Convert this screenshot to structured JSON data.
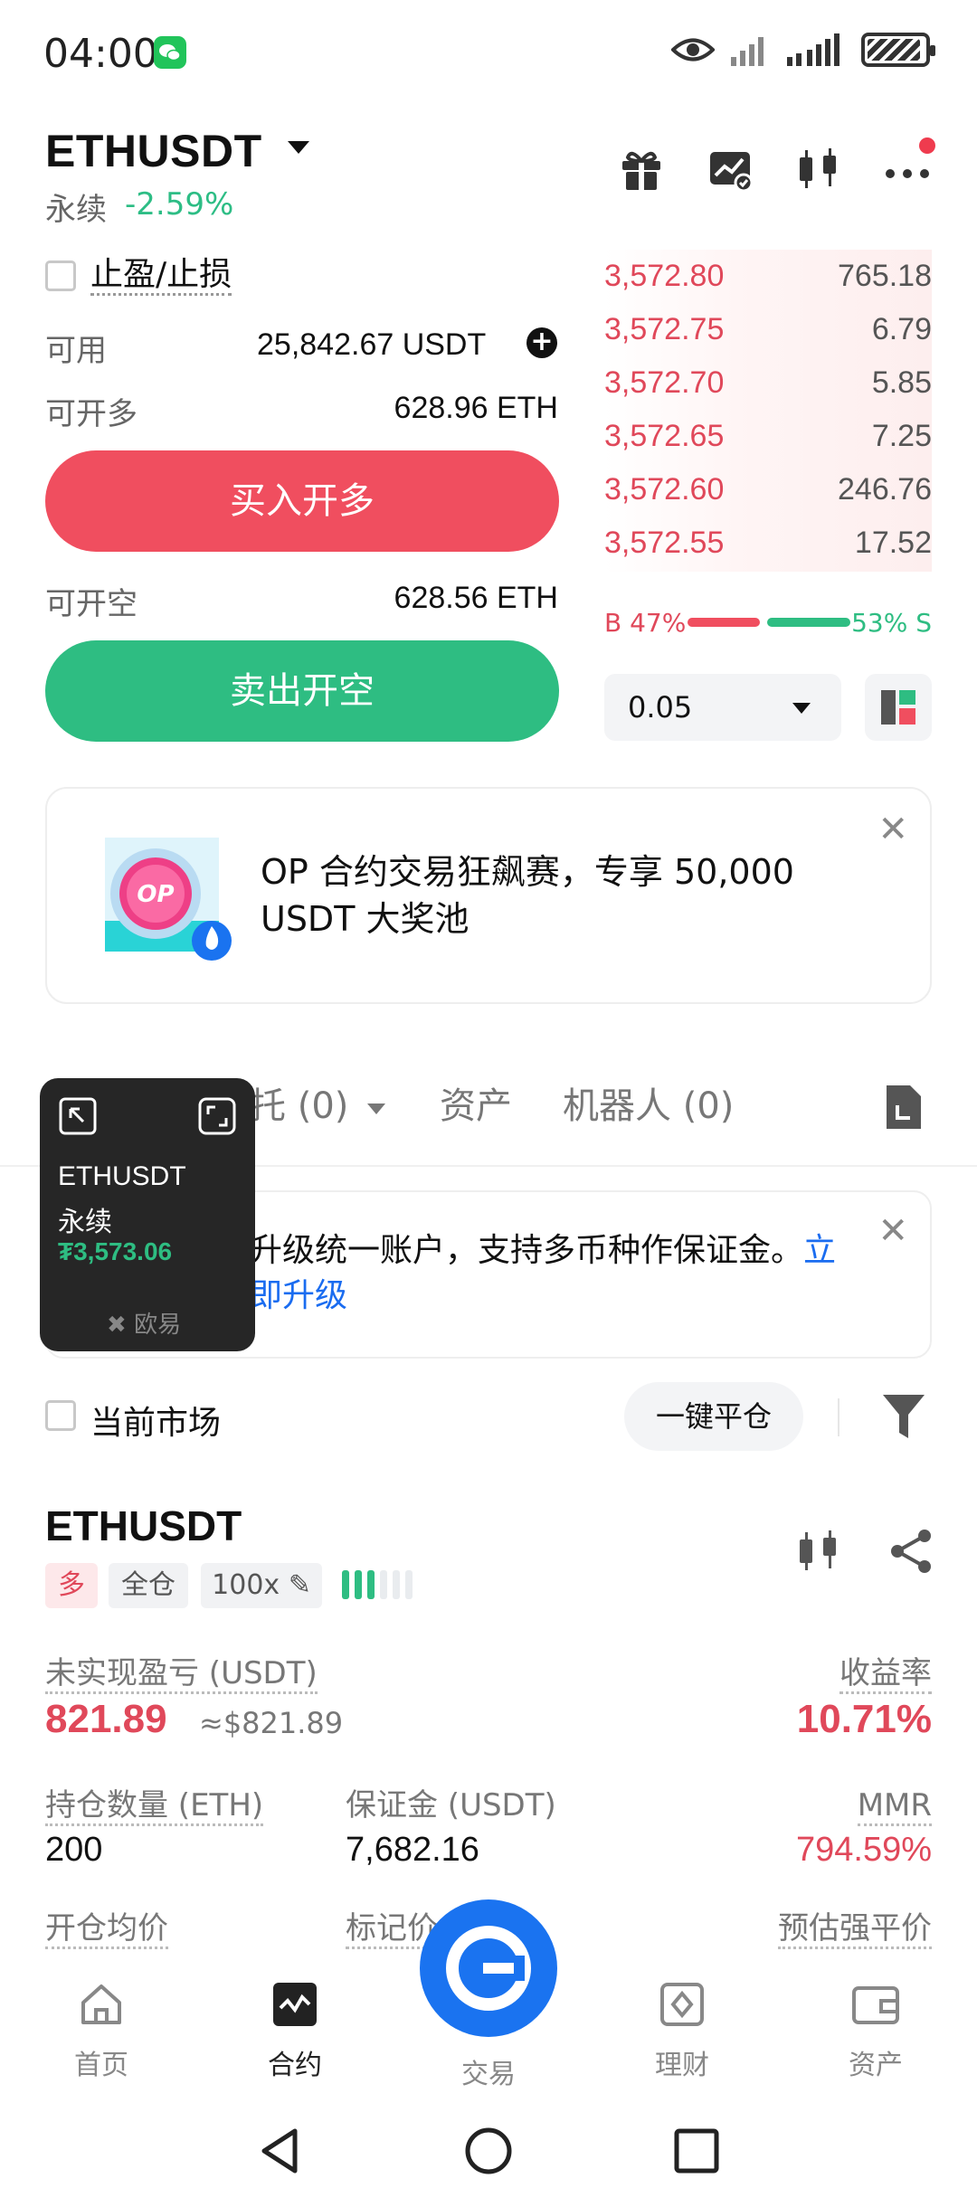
{
  "status_bar": {
    "time": "04:00"
  },
  "header": {
    "pair": "ETHUSDT",
    "contract_type": "永续",
    "change": "-2.59%"
  },
  "trade_panel": {
    "tpsl_label": "止盈/止损",
    "available_label": "可用",
    "available_value": "25,842.67 USDT",
    "open_long_label": "可开多",
    "open_long_value": "628.96 ETH",
    "buy_button": "买入开多",
    "open_short_label": "可开空",
    "open_short_value": "628.56 ETH",
    "sell_button": "卖出开空"
  },
  "order_book": {
    "asks": [
      {
        "price": "3,572.80",
        "size": "765.18"
      },
      {
        "price": "3,572.75",
        "size": "6.79"
      },
      {
        "price": "3,572.70",
        "size": "5.85"
      },
      {
        "price": "3,572.65",
        "size": "7.25"
      },
      {
        "price": "3,572.60",
        "size": "246.76"
      },
      {
        "price": "3,572.55",
        "size": "17.52"
      }
    ],
    "buy_ratio": "B 47%",
    "sell_ratio": "53% S",
    "buy_ratio_value": 47,
    "sell_ratio_value": 53,
    "depth": "0.05"
  },
  "promo": {
    "badge_text": "OP",
    "text": "OP 合约交易狂飙赛，专享 50,000 USDT 大奖池"
  },
  "tabs": {
    "orders": "委托 (0)",
    "orders_visible": "托 (0)",
    "assets": "资产",
    "bots": "机器人 (0)"
  },
  "notice": {
    "text_visible": "升级统一账户，支持多币种作保证金。",
    "link_part1": "立",
    "link_part2": "即升级"
  },
  "pip": {
    "title": "ETHUSDT",
    "subtitle": "永续",
    "price": "₮3,573.06",
    "brand": "欧易"
  },
  "filter": {
    "current_market": "当前市场",
    "close_all": "一键平仓"
  },
  "position": {
    "symbol": "ETHUSDT",
    "side": "多",
    "margin_mode": "全仓",
    "leverage": "100x",
    "risk_level_on": 3,
    "risk_level_total": 6,
    "upnl_label": "未实现盈亏 (USDT)",
    "upnl_value": "821.89",
    "upnl_approx": "≈$821.89",
    "roe_label": "收益率",
    "roe_value": "10.71%",
    "size_label": "持仓数量 (ETH)",
    "size_value": "200",
    "margin_label": "保证金 (USDT)",
    "margin_value": "7,682.16",
    "mmr_label": "MMR",
    "mmr_value": "794.59%",
    "entry_label": "开仓均价",
    "mark_label_visible": "标记价",
    "liq_label": "预估强平价"
  },
  "bottom_nav": {
    "home": "首页",
    "futures": "合约",
    "trade": "交易",
    "earn": "理财",
    "assets": "资产"
  },
  "colors": {
    "red": "#f04e5f",
    "green": "#2ebd82",
    "blue": "#1a73f0"
  }
}
